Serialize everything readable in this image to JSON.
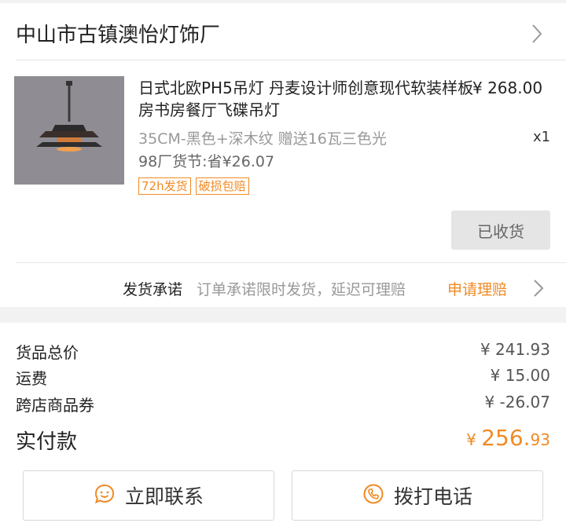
{
  "shop": {
    "name": "中山市古镇澳怡灯饰厂"
  },
  "product": {
    "title": "日式北欧PH5吊灯 丹麦设计师创意现代软装样板房书房餐厅飞碟吊灯",
    "price": "¥ 268.00",
    "variant": "35CM-黑色+深木纹 赠送16瓦三色光",
    "quantity": "x1",
    "savings": "98厂货节:省¥26.07",
    "tags": [
      "72h发货",
      "破损包赔"
    ],
    "status_button": "已收货"
  },
  "shipping_promise": {
    "label": "发货承诺",
    "text": "订单承诺限时发货，延迟可理赔",
    "link": "申请理赔"
  },
  "summary": {
    "rows": [
      {
        "label": "货品总价",
        "value": "¥ 241.93"
      },
      {
        "label": "运费",
        "value": "¥ 15.00"
      },
      {
        "label": "跨店商品券",
        "value": "¥ -26.07"
      }
    ],
    "paid_label": "实付款",
    "paid_currency": "¥ ",
    "paid_integer": "256.",
    "paid_decimal": "93"
  },
  "actions": {
    "contact": "立即联系",
    "call": "拨打电话"
  },
  "colors": {
    "accent": "#f08a24",
    "background": "#f2f2f2",
    "button_gray": "#e5e5e5"
  },
  "icons": {
    "shop_chevron": "chevron-right-icon",
    "promise_chevron": "chevron-right-icon",
    "contact": "chat-smile-icon",
    "call": "phone-icon"
  }
}
